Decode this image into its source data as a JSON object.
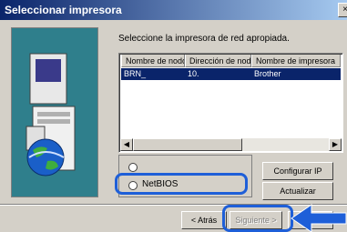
{
  "window": {
    "title": "Seleccionar impresora",
    "close_glyph": "×"
  },
  "prompt": "Seleccione la impresora de red apropiada.",
  "list": {
    "columns": [
      "Nombre de nodo",
      "Dirección de nodo",
      "Nombre de impresora"
    ],
    "rows": [
      {
        "node_name": "BRN_",
        "node_address": "10.",
        "printer_name": "Brother"
      }
    ],
    "selected_row": 0
  },
  "protocol": {
    "options": [
      {
        "label": ""
      },
      {
        "label": "NetBIOS"
      }
    ]
  },
  "buttons": {
    "configure_ip": "Configurar IP",
    "refresh": "Actualizar",
    "back": "< Atrás",
    "next": "Siguiente >"
  },
  "colors": {
    "highlight_outline": "#1e5fd8",
    "selection": "#0a246a",
    "dialog_face": "#d4d0c8"
  },
  "icons": [
    "computer-icon",
    "globe-icon",
    "arrow-pointer-icon"
  ]
}
